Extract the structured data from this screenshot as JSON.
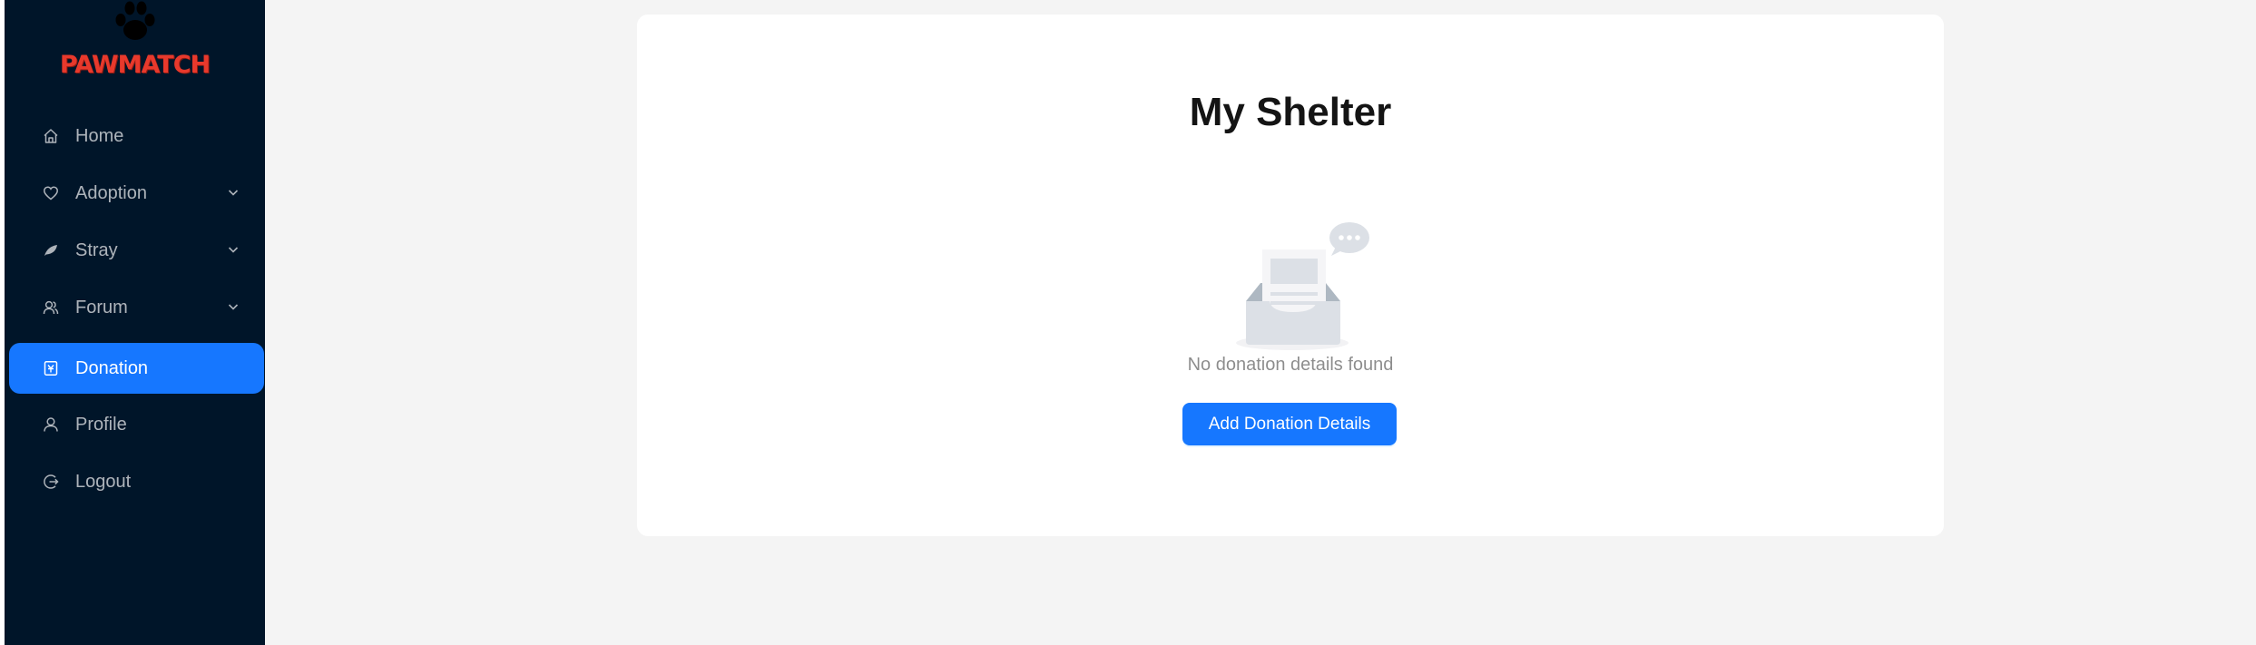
{
  "app": {
    "brand": "PAWMATCH",
    "logo_icon": "paw-icon",
    "brand_color": "#e8392c"
  },
  "sidebar": {
    "background": "#001529",
    "active_color": "#1677ff",
    "items": [
      {
        "label": "Home",
        "icon": "home-icon",
        "has_submenu": false,
        "active": false
      },
      {
        "label": "Adoption",
        "icon": "heart-icon",
        "has_submenu": true,
        "active": false
      },
      {
        "label": "Stray",
        "icon": "leaf-icon",
        "has_submenu": true,
        "active": false
      },
      {
        "label": "Forum",
        "icon": "users-icon",
        "has_submenu": true,
        "active": false
      },
      {
        "label": "Donation",
        "icon": "donation-icon",
        "has_submenu": false,
        "active": true
      },
      {
        "label": "Profile",
        "icon": "user-icon",
        "has_submenu": false,
        "active": false
      },
      {
        "label": "Logout",
        "icon": "logout-icon",
        "has_submenu": false,
        "active": false
      }
    ]
  },
  "main": {
    "title": "My Shelter",
    "empty_state": {
      "icon": "empty-inbox-icon",
      "message": "No donation details found"
    },
    "add_button_label": "Add Donation Details"
  }
}
